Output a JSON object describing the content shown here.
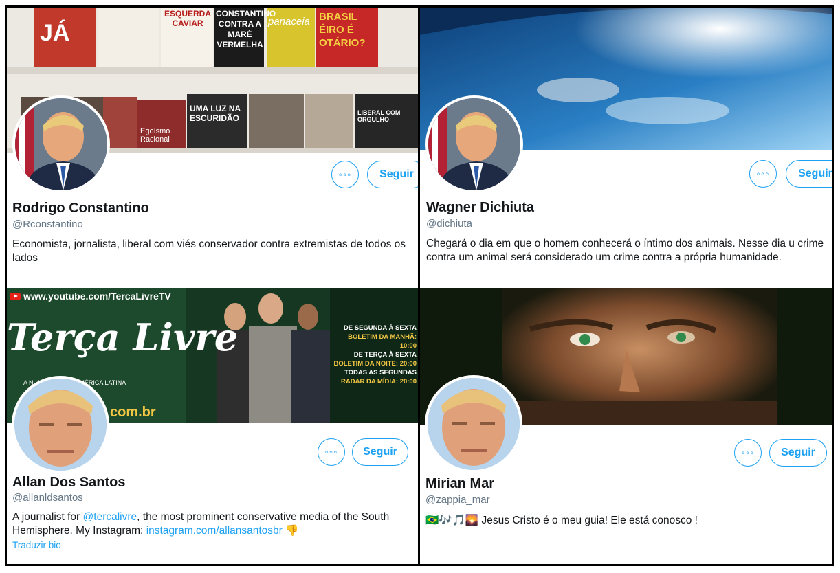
{
  "profiles": [
    {
      "name": "Rodrigo Constantino",
      "handle": "@Rconstantino",
      "bio": "Economista, jornalista, liberal com viés conservador contra extremistas de todos os lados",
      "follow_label": "Seguir",
      "more_label": "◦◦◦",
      "banner_books": [
        "JÁ",
        "ESQUERDA CAVIAR",
        "CONSTANTINO CONTRA A MARÉ VERMELHA",
        "panaceia",
        "BRASIL ÉIRO É OTÁRIO?",
        "UMA LUZ NA ESCURIDÃO",
        "Egoísmo Racional",
        "LIBERAL COM ORGULHO"
      ]
    },
    {
      "name": "Wagner Dichiuta",
      "handle": "@dichiuta",
      "bio": "Chegará o dia em que o homem conhecerá o íntimo dos animais. Nesse dia u crime contra um animal será considerado um crime contra a própria humanidade.",
      "follow_label": "Seguir",
      "more_label": "◦◦◦"
    },
    {
      "name": "Allan Dos Santos",
      "handle": "@allanldsantos",
      "bio_pre": "A journalist for ",
      "bio_link1": "@tercalivre",
      "bio_mid": ", the most prominent conservative media of the South Hemisphere. My Instagram: ",
      "bio_link2": "instagram.com/allansantosbr",
      "bio_emoji": "👎",
      "translate": "Traduzir bio",
      "follow_label": "Seguir",
      "more_label": "◦◦◦",
      "banner": {
        "url": "www.youtube.com/TercaLivreTV",
        "brand": "Terça Livre",
        "tagline": "A N...VADORA DA AMÉRICA LATINA",
        "domain": "com.br",
        "schedule": [
          "DE SEGUNDA À SEXTA",
          "BOLETIM DA MANHÃ: 10:00",
          "DE TERÇA À SEXTA",
          "BOLETIM DA NOITE: 20:00",
          "TODAS AS SEGUNDAS",
          "RADAR DA MÍDIA: 20:00"
        ]
      }
    },
    {
      "name": "Mirian Mar",
      "handle": "@zappia_mar",
      "bio_emoji": "🇧🇷🎶🎵🌄",
      "bio": "Jesus Cristo é o meu guia! Ele está conosco !",
      "follow_label": "Seguir",
      "more_label": "◦◦◦"
    }
  ],
  "colors": {
    "accent": "#1da1f2",
    "text": "#14171a",
    "muted": "#657786"
  }
}
